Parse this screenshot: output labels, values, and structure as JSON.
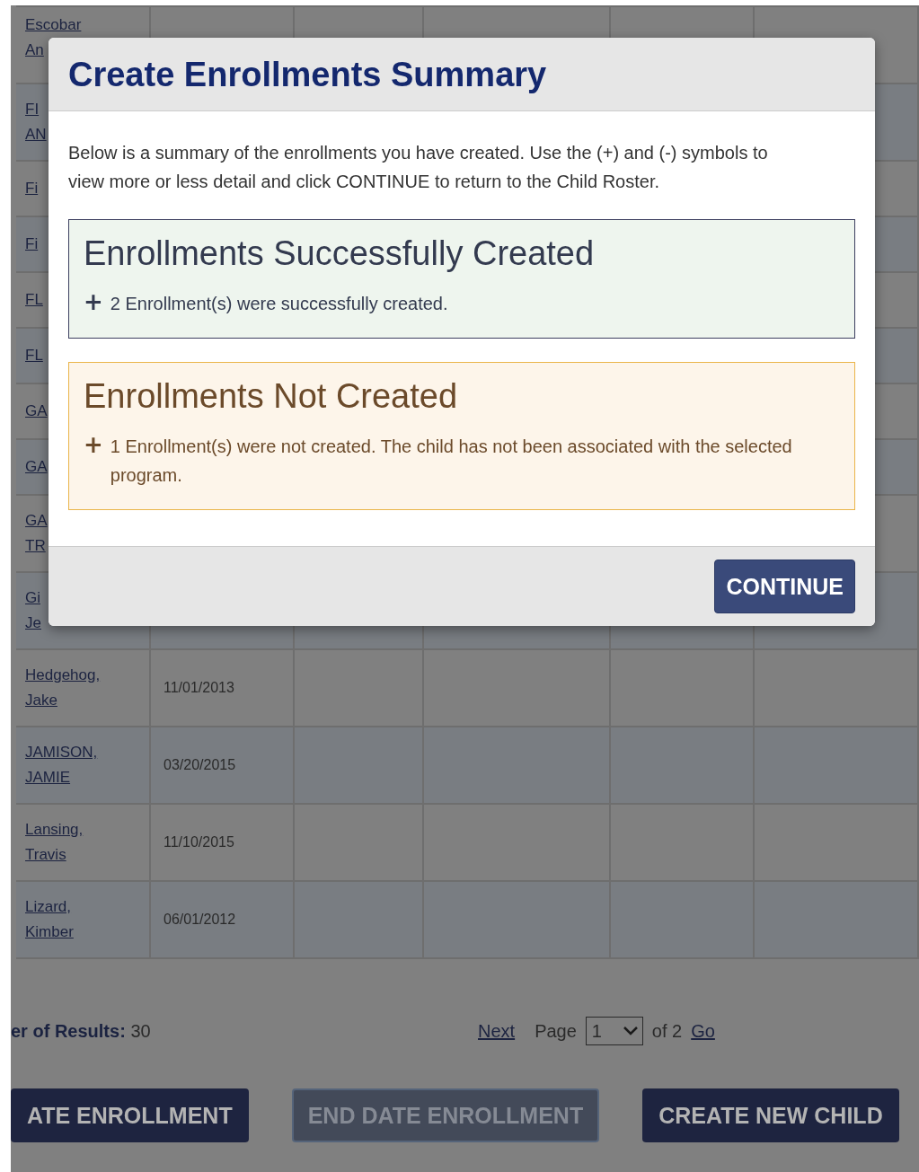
{
  "roster": {
    "rows": [
      {
        "name_lines": [
          "Escobar",
          "An"
        ]
      },
      {
        "name_lines": [
          "FI",
          "AN"
        ]
      },
      {
        "name_lines": [
          "Fi"
        ]
      },
      {
        "name_lines": [
          "Fi"
        ]
      },
      {
        "name_lines": [
          "FL"
        ]
      },
      {
        "name_lines": [
          "FL"
        ]
      },
      {
        "name_lines": [
          "GA"
        ]
      },
      {
        "name_lines": [
          "GA"
        ]
      },
      {
        "name_lines": [
          "GA",
          "TR"
        ]
      },
      {
        "name_lines": [
          "Gi",
          "Je"
        ]
      },
      {
        "name_lines": [
          "Hedgehog,",
          "Jake"
        ],
        "birth_date": "11/01/2013"
      },
      {
        "name_lines": [
          "JAMISON,",
          "JAMIE"
        ],
        "birth_date": "03/20/2015"
      },
      {
        "name_lines": [
          "Lansing,",
          "Travis"
        ],
        "birth_date": "11/10/2015"
      },
      {
        "name_lines": [
          "Lizard,",
          "Kimber"
        ],
        "birth_date": "06/01/2012"
      }
    ]
  },
  "results": {
    "label": "er of Results:",
    "count": "30"
  },
  "pagination": {
    "next": "Next",
    "page_label": "Page",
    "page_value": "1",
    "of_label": "of 2",
    "go": "Go"
  },
  "actions": [
    {
      "label": "ATE ENROLLMENT",
      "disabled": false
    },
    {
      "label": "END DATE ENROLLMENT",
      "disabled": true
    },
    {
      "label": "CREATE NEW CHILD",
      "disabled": false
    }
  ],
  "modal": {
    "title": "Create Enrollments Summary",
    "intro": "Below is a summary of the enrollments you have created. Use the (+) and (-) symbols to view more or less detail and click CONTINUE to return to the Child Roster.",
    "sections": [
      {
        "kind": "success",
        "title": "Enrollments Successfully Created",
        "toggle": "+",
        "expanded": false,
        "message": "2 Enrollment(s) were successfully created."
      },
      {
        "kind": "failure",
        "title": "Enrollments Not Created",
        "toggle": "+",
        "expanded": false,
        "message": "1 Enrollment(s) were not created. The child has not been associated with the selected program."
      }
    ],
    "button": "CONTINUE"
  }
}
